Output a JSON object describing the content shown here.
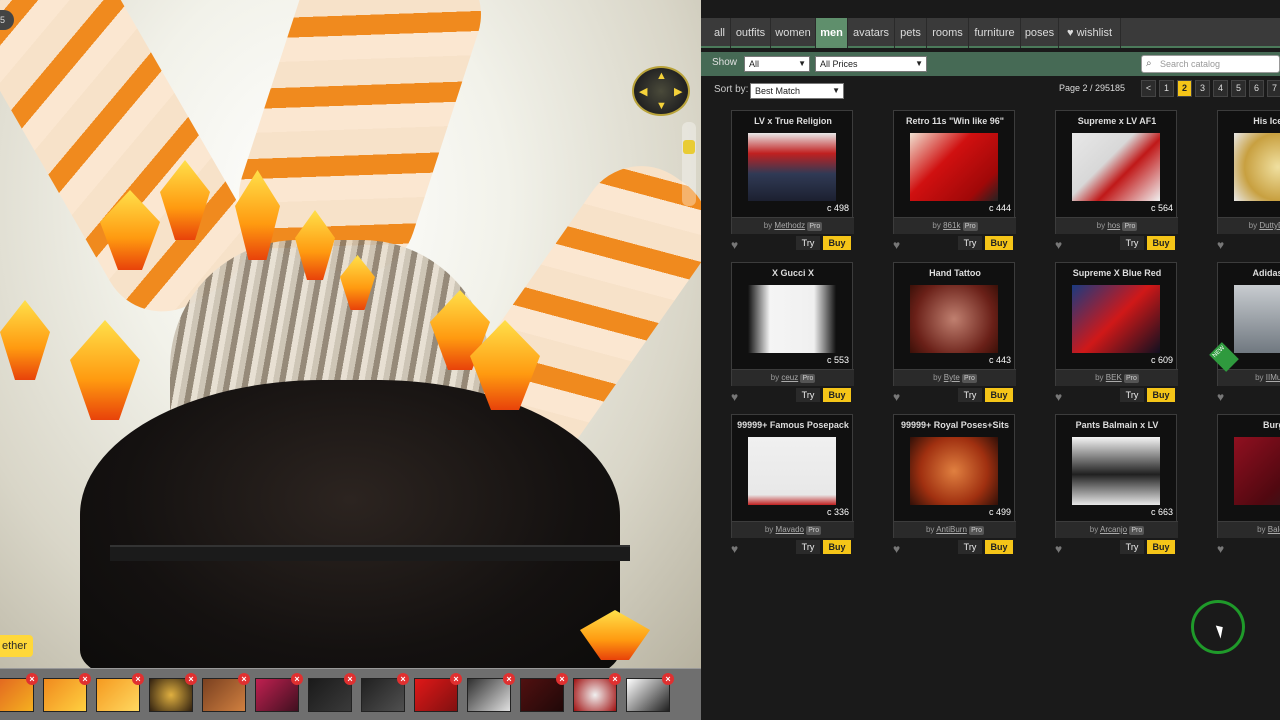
{
  "scene": {
    "left_tag": "ether",
    "top_tag": "5"
  },
  "tray": {
    "thumbs": [
      {
        "bg": "linear-gradient(135deg,#e06020,#f5b020)"
      },
      {
        "bg": "linear-gradient(135deg,#f08a1e,#ffd040)"
      },
      {
        "bg": "linear-gradient(135deg,#f59a20,#ffd860)"
      },
      {
        "bg": "radial-gradient(circle,#e0b040,#302010)"
      },
      {
        "bg": "linear-gradient(135deg,#7a4020,#d08040)"
      },
      {
        "bg": "linear-gradient(135deg,#c02050,#401020)"
      },
      {
        "bg": "linear-gradient(135deg,#1a1a1a,#3a3a3a)"
      },
      {
        "bg": "linear-gradient(135deg,#202020,#505050)"
      },
      {
        "bg": "linear-gradient(135deg,#e01818,#801010)"
      },
      {
        "bg": "linear-gradient(135deg,#303030,#e0e0e0)"
      },
      {
        "bg": "linear-gradient(135deg,#501010,#200808)"
      },
      {
        "bg": "radial-gradient(circle,#f0f0f0,#a01010)"
      },
      {
        "bg": "linear-gradient(135deg,#ffffff,#202020)"
      }
    ]
  },
  "catalog": {
    "tabs": [
      "all",
      "outfits",
      "women",
      "men",
      "avatars",
      "pets",
      "rooms",
      "furniture",
      "poses",
      "wishlist"
    ],
    "active_tab": "men",
    "show_label": "Show",
    "show_value": "All",
    "price_value": "All Prices",
    "search_placeholder": "Search catalog",
    "sort_label": "Sort by:",
    "sort_value": "Best Match",
    "page_info": "Page 2 / 295185",
    "pages": [
      "<",
      "1",
      "2",
      "3",
      "4",
      "5",
      "6",
      "7"
    ],
    "current_page": "2",
    "try_label": "Try",
    "buy_label": "Buy",
    "by_label": "by",
    "pro_label": "Pro",
    "new_label": "NEW",
    "items": [
      {
        "title": "LV x True Religion",
        "price": "498",
        "creator": "Methodz",
        "img": "linear-gradient(180deg,#e8e8e8 0%,#c02020 30%,#303a55 60%,#1c2030 100%)"
      },
      {
        "title": "Retro 11s \"Win like 96\"",
        "price": "444",
        "creator": "861k",
        "img": "linear-gradient(135deg,#f0e0d0 0%,#d01010 40%,#a00808 80%,#222 100%)"
      },
      {
        "title": "Supreme x LV AF1",
        "price": "564",
        "creator": "hos",
        "img": "linear-gradient(135deg,#e8e8e8 0%,#d8d8d8 40%,#c01818 60%,#f0f0f0 100%)"
      },
      {
        "title": "His Iced Rol",
        "price": "",
        "creator": "DuttyDes",
        "img": "radial-gradient(circle,#f0e0a0 0%,#c8a040 60%,#e8e8e8 100%)"
      },
      {
        "title": "X Gucci X",
        "price": "553",
        "creator": "ceuz",
        "img": "linear-gradient(90deg,#111 0%,#f5f5f5 25%,#f0f0f0 75%,#111 100%)"
      },
      {
        "title": "Hand Tattoo",
        "price": "443",
        "creator": "Byte",
        "img": "radial-gradient(circle,#c08070 0%,#6a2018 70%,#3a1008 100%)"
      },
      {
        "title": "Supreme X Blue Red",
        "price": "609",
        "creator": "BEK",
        "img": "linear-gradient(135deg,#1a3a80 0%,#d01818 50%,#101020 100%)"
      },
      {
        "title": "Adidas Spor",
        "price": "",
        "creator": "IIMuri",
        "img": "linear-gradient(180deg,#c8ccd0 0%,#707880 100%)",
        "new": true
      },
      {
        "title": "99999+ Famous Posepack",
        "price": "336",
        "creator": "Mavado",
        "img": "linear-gradient(180deg,#f0f0f0 0%,#e8e8e8 85%,#c02020 100%)"
      },
      {
        "title": "99999+ Royal Poses+Sits",
        "price": "499",
        "creator": "AntiBurn",
        "img": "radial-gradient(circle,#e08040 0%,#a03010 60%,#301008 100%)"
      },
      {
        "title": "Pants Balmain x LV",
        "price": "663",
        "creator": "Arcanjo",
        "img": "linear-gradient(180deg,#f5f5f5 0%,#202020 55%,#e8e8e8 100%)"
      },
      {
        "title": "Burgun",
        "price": "",
        "creator": "Balo",
        "img": "linear-gradient(135deg,#901020 0%,#500810 60%,#202020 100%)"
      }
    ]
  }
}
